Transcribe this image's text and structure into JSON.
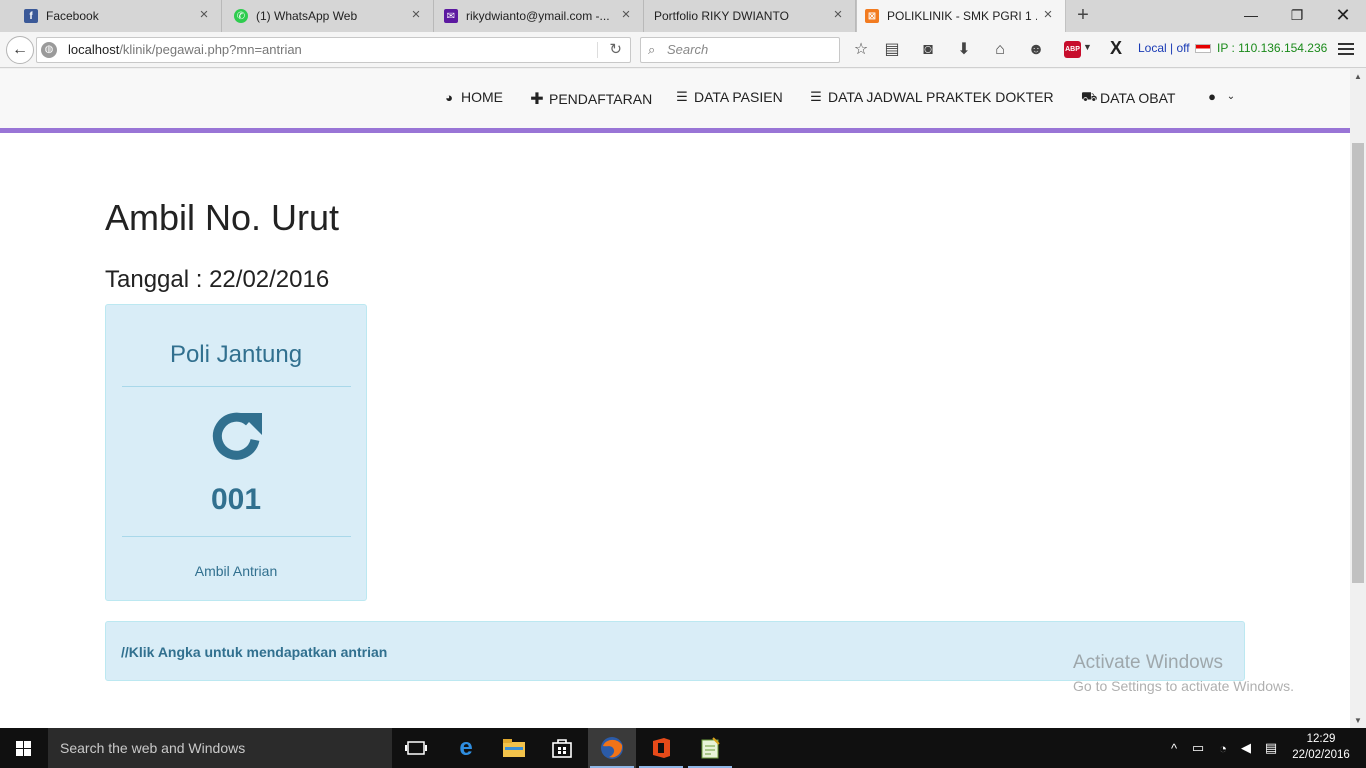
{
  "browser": {
    "tabs": [
      {
        "title": "Facebook",
        "icon": "facebook-icon",
        "icon_color": "#3b5998",
        "glyph": "f"
      },
      {
        "title": "(1) WhatsApp Web",
        "icon": "whatsapp-icon",
        "icon_color": "#2ecc4e",
        "glyph": "✆"
      },
      {
        "title": "rikydwianto@ymail.com -...",
        "icon": "yahoo-mail-icon",
        "icon_color": "#5c19a0",
        "glyph": "✉"
      },
      {
        "title": "Portfolio RIKY DWIANTO",
        "icon": "",
        "icon_color": "",
        "glyph": ""
      },
      {
        "title": "POLIKLINIK - SMK PGRI 1 ...",
        "icon": "xampp-icon",
        "icon_color": "#f27b20",
        "glyph": "⊠"
      }
    ],
    "url_host": "localhost",
    "url_path": "/klinik/pegawai.php?mn=antrian",
    "search_placeholder": "Search",
    "local_status": "Local | off",
    "ip_text": "IP : 110.136.154.236",
    "abp_label": "ABP"
  },
  "site_nav": {
    "items": [
      {
        "label": "HOME",
        "icon": "dashboard-icon"
      },
      {
        "label": "PENDAFTARAN",
        "icon": "plus-icon"
      },
      {
        "label": "DATA PASIEN",
        "icon": "list-icon"
      },
      {
        "label": "DATA JADWAL PRAKTEK DOKTER",
        "icon": "list-icon"
      },
      {
        "label": "DATA OBAT",
        "icon": "truck-icon"
      }
    ],
    "user_menu_icon": "user-icon"
  },
  "main": {
    "title": "Ambil No. Urut",
    "date_line": "Tanggal : 22/02/2016",
    "poli": {
      "name": "Poli Jantung",
      "number": "001",
      "action": "Ambil Antrian"
    },
    "hint": "//Klik Angka untuk mendapatkan antrian"
  },
  "watermark": {
    "line1": "Activate Windows",
    "line2": "Go to Settings to activate Windows."
  },
  "taskbar": {
    "search_placeholder": "Search the web and Windows",
    "time": "12:29",
    "date": "22/02/2016"
  },
  "colors": {
    "accent_purple": "#9975d6",
    "info_text": "#31708f",
    "info_bg": "#d9edf7"
  }
}
